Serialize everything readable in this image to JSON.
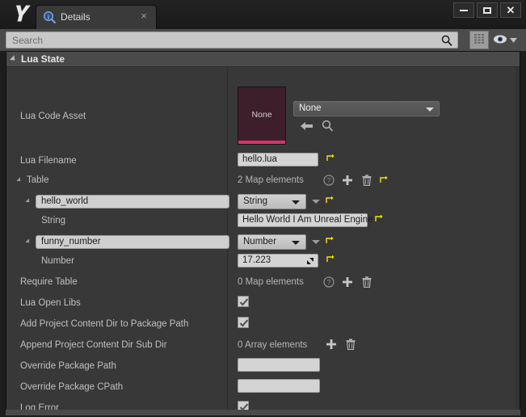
{
  "window": {
    "title": "Details",
    "controls": {
      "minimize": "minimize",
      "maximize": "maximize",
      "close": "close"
    },
    "logo": "unreal-engine-logo",
    "tab_close": "×"
  },
  "search": {
    "placeholder": "Search",
    "icon": "search-icon",
    "grid_button": "grid-view-icon",
    "eye_button": "eye-icon",
    "eye_chevron": "chevron-down-icon"
  },
  "category": {
    "title": "Lua State",
    "expander": "expanded-triangle"
  },
  "properties": {
    "lua_code_asset": {
      "label": "Lua Code Asset",
      "thumbnail_caption": "None",
      "combo_value": "None",
      "back_icon": "arrow-left-icon",
      "browse_icon": "browse-magnifier-icon"
    },
    "lua_filename": {
      "label": "Lua Filename",
      "value": "hello.lua",
      "reset": "reset-arrow-icon"
    },
    "table": {
      "label": "Table",
      "elements": "2 Map elements",
      "help_icon": "help-circle-icon",
      "add_icon": "plus-icon",
      "delete_icon": "trash-icon",
      "reset_icon": "reset-arrow-icon",
      "entries": [
        {
          "key": "hello_world",
          "type": "String",
          "child_label": "String",
          "child_value": "Hello World I Am Unreal Engine"
        },
        {
          "key": "funny_number",
          "type": "Number",
          "child_label": "Number",
          "child_value": "17.223"
        }
      ]
    },
    "require_table": {
      "label": "Require Table",
      "elements": "0 Map elements",
      "help_icon": "help-circle-icon",
      "add_icon": "plus-icon",
      "delete_icon": "trash-icon"
    },
    "lua_open_libs": {
      "label": "Lua Open Libs",
      "checked": true
    },
    "add_project_content_dir": {
      "label": "Add Project Content Dir to Package Path",
      "checked": true
    },
    "append_project_content_sub_dir": {
      "label": "Append Project Content Dir Sub Dir",
      "elements": "0 Array elements",
      "add_icon": "plus-icon",
      "delete_icon": "trash-icon"
    },
    "override_package_path": {
      "label": "Override Package Path",
      "value": ""
    },
    "override_package_cpath": {
      "label": "Override Package CPath",
      "value": ""
    },
    "log_error": {
      "label": "Log Error",
      "checked": true
    }
  },
  "colors": {
    "panel_bg": "#383838",
    "header_bg": "#4a4a4a",
    "accent_pink": "#e0306a",
    "thumb_bg": "#3d1f2b",
    "reset_yellow": "#f2e600",
    "field_light": "#d4d4d4"
  }
}
